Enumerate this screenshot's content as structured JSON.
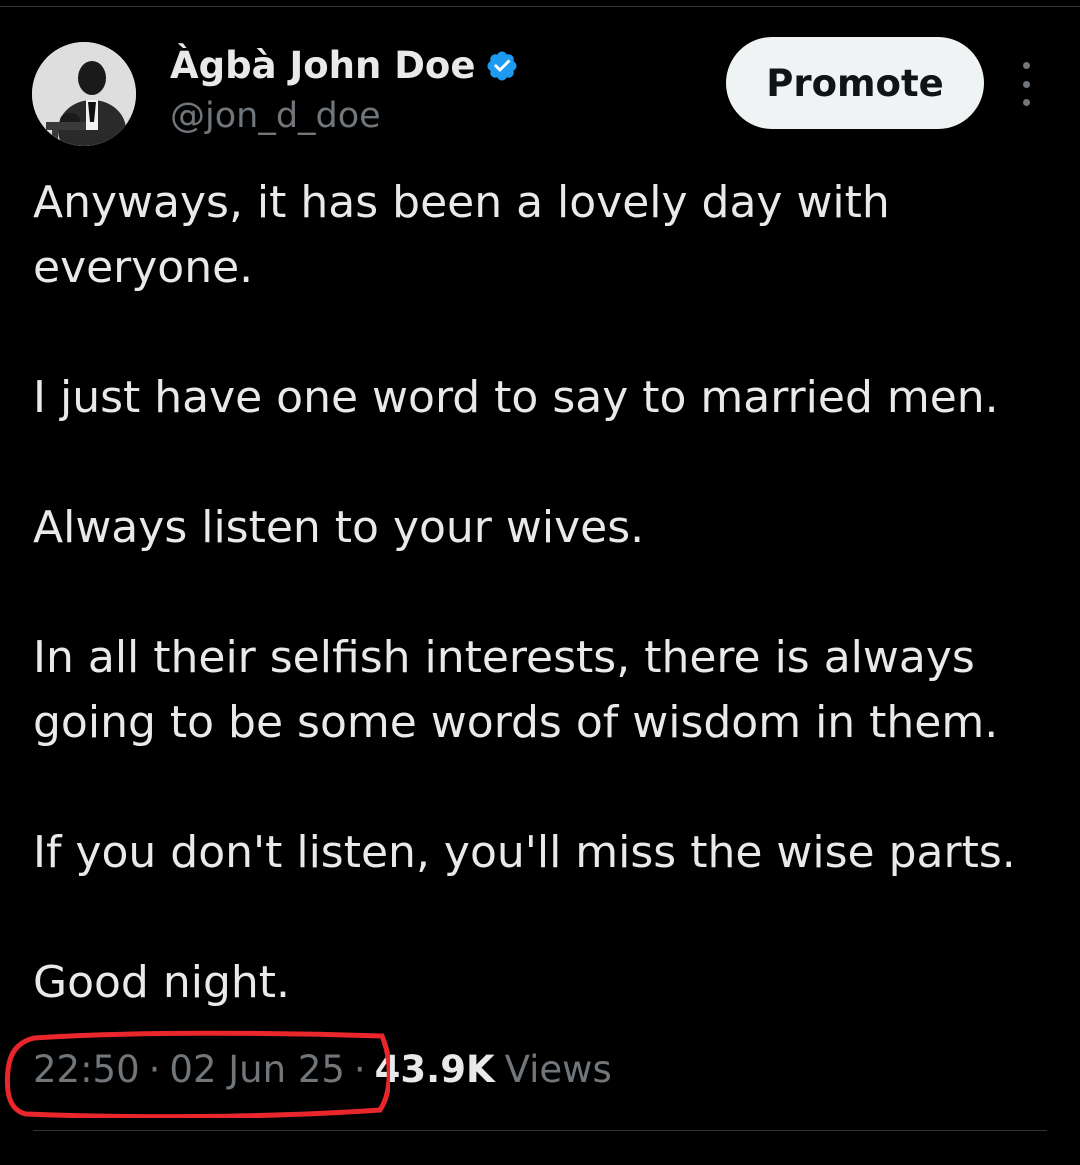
{
  "author": {
    "display_name": "Àgbà John Doe",
    "handle": "@jon_d_doe",
    "verified": true,
    "verified_color": "#1d9bf0"
  },
  "actions": {
    "promote_label": "Promote",
    "more_icon": "more-vertical-icon"
  },
  "tweet": {
    "paragraphs": [
      "Anyways, it has been a lovely day with everyone.",
      "I just have one word to say to married men.",
      "Always listen to your wives.",
      "In all their selfish interests, there is always going to be some words of wisdom in them.",
      "If you don't listen, you'll miss the wise parts.",
      "Good night."
    ]
  },
  "meta": {
    "time": "22:50",
    "separator": "·",
    "date": "02 Jun 25",
    "views_count": "43.9K",
    "views_label": "Views"
  },
  "annotation": {
    "color": "#e8262b"
  },
  "theme": {
    "background": "#000000",
    "text": "#e7e9ea",
    "muted": "#71767b"
  }
}
